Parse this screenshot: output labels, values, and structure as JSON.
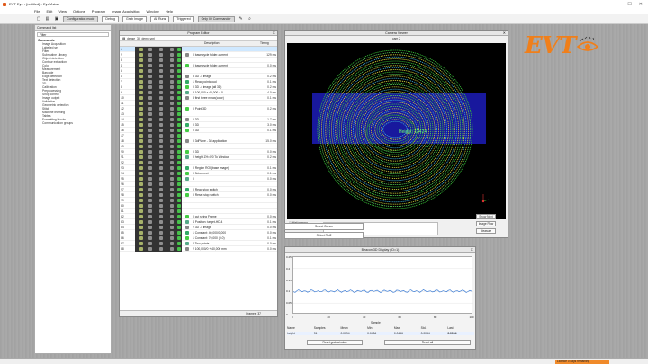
{
  "window": {
    "title": "EVT Eye - [untitled] - EyeVision",
    "controls": [
      "—",
      "☐",
      "✕"
    ]
  },
  "menu": [
    "File",
    "Edit",
    "View",
    "Options",
    "Program",
    "Image Acquisition",
    "Window",
    "Help"
  ],
  "toolbar": {
    "config": "Configuration mode",
    "debug": "Debug",
    "grab": "Grab Image",
    "all_runs": "All Runs",
    "triggered": "Triggered",
    "device": "Only IO Commander"
  },
  "commands": {
    "title": "Command list",
    "filter": "Filter",
    "group": "Commands",
    "items": [
      "Image Acquisition",
      "Labelled set",
      "Filter",
      "Subroutine Library",
      "Object detection",
      "Contour extraction",
      "Color",
      "Measurement",
      "Barcode",
      "Edge detection",
      "Text detection",
      "3D",
      "Calibration",
      "Preprocessing",
      "Shop control",
      "Image output",
      "Validation",
      "Geometric detection",
      "Stitch",
      "Machine learning",
      "Tables",
      "Formatting blocks",
      "Communication groups"
    ]
  },
  "program": {
    "title": "Program Editor",
    "tab": "dense_3d_demo.vprj",
    "col_step": "Description",
    "col_time": "Timing",
    "footer": "Frames: 37",
    "rows": [
      {
        "n": "1",
        "step": "",
        "t": "",
        "sel": true
      },
      {
        "n": "2",
        "step": "0 base cycle folder-current",
        "t": "129 ms"
      },
      {
        "n": "3",
        "step": "",
        "t": ""
      },
      {
        "n": "4",
        "step": "0 base cycle folder-current",
        "t": "0.0 ms"
      },
      {
        "n": "5",
        "step": "",
        "t": ""
      },
      {
        "n": "6",
        "step": "3 3D -> image",
        "t": "0.2 ms"
      },
      {
        "n": "7",
        "step": "1 Read pointcloud",
        "t": "0.1 ms"
      },
      {
        "n": "8",
        "step": "0 3D -> image (all 3D)",
        "t": "0.2 ms"
      },
      {
        "n": "9",
        "step": "3 100,000 x 40,000 = 0",
        "t": "4.0 ms"
      },
      {
        "n": "10",
        "step": "3 first three nmax(color)",
        "t": "0.1 ms"
      },
      {
        "n": "11",
        "step": "",
        "t": ""
      },
      {
        "n": "12",
        "step": "0 Point 3D",
        "t": "0.2 ms"
      },
      {
        "n": "13",
        "step": "",
        "t": ""
      },
      {
        "n": "14",
        "step": "0 3D",
        "t": "1.7 ms"
      },
      {
        "n": "15",
        "step": "0 3D",
        "t": "3.0 ms"
      },
      {
        "n": "16",
        "step": "0 3D",
        "t": "0.1 ms"
      },
      {
        "n": "17",
        "step": "",
        "t": ""
      },
      {
        "n": "18",
        "step": "0 3dPlane - 3d application",
        "t": "15.0 ms"
      },
      {
        "n": "19",
        "step": "",
        "t": ""
      },
      {
        "n": "20",
        "step": "0 3D",
        "t": "0.0 ms"
      },
      {
        "n": "21",
        "step": "0 height ZH=0/0 To Window",
        "t": "0.2 ms"
      },
      {
        "n": "22",
        "step": "",
        "t": ""
      },
      {
        "n": "23",
        "step": "0 Region ROI (base image)",
        "t": "0.1 ms"
      },
      {
        "n": "24",
        "step": "0 3d-correct",
        "t": "0.1 ms"
      },
      {
        "n": "25",
        "step": "0",
        "t": "0.0 ms"
      },
      {
        "n": "26",
        "step": "",
        "t": ""
      },
      {
        "n": "27",
        "step": "0 Read stop switch",
        "t": "0.0 ms"
      },
      {
        "n": "28",
        "step": "0 Reset stop switch",
        "t": "0.0 ms"
      },
      {
        "n": "29",
        "step": "",
        "t": ""
      },
      {
        "n": "30",
        "step": "",
        "t": ""
      },
      {
        "n": "31",
        "step": "",
        "t": ""
      },
      {
        "n": "32",
        "step": "0 cut string Frame",
        "t": "0.0 ms"
      },
      {
        "n": "33",
        "step": "4 Position: target-HD.4",
        "t": "0.1 ms"
      },
      {
        "n": "34",
        "step": "2 3D -> image",
        "t": "0.0 ms"
      },
      {
        "n": "35",
        "step": "1 Constant: 40,000/0,000",
        "t": "0.0 ms"
      },
      {
        "n": "36",
        "step": "1 Constant: 70,000 (0.0)",
        "t": "0.1 ms"
      },
      {
        "n": "37",
        "step": "2 Two points",
        "t": "0.0 ms"
      },
      {
        "n": "38",
        "step": "2 100,000/0 + 40,000 mm",
        "t": "0.0 ms"
      }
    ]
  },
  "camera": {
    "title": "Camera Viewer",
    "sub": "cam 2",
    "overlay": "Height: 13424",
    "checks": [
      "Hist/gamma",
      "auto center",
      "auto scale"
    ],
    "buttons": [
      "Show Next",
      "Image Flow",
      "Measure"
    ]
  },
  "select": {
    "a": "Select Cursor",
    "b": "Select Roi2"
  },
  "plot": {
    "title": "Beacon 3D Display (ID=1)",
    "yticks": [
      "0.25",
      "0.2",
      "0.15",
      "0.1",
      "0.05",
      "0"
    ],
    "xticks": [
      "0",
      "20",
      "40",
      "60",
      "80",
      "100"
    ],
    "xlabel": "Sample",
    "stats_head": [
      "Name",
      "Samples",
      "Mean",
      "Min",
      "Max",
      "Std.",
      "Last"
    ],
    "stats_row": [
      "height",
      "91",
      "0.0094",
      "0.0484",
      "0.0456",
      "0.0044",
      "0.0094"
    ],
    "btn_reset": "Reset grab window",
    "btn_all": "Reset all",
    "series_color": "#3a7bd5"
  },
  "status": {
    "warn": "Licence 0 days remaining"
  },
  "logo": "EVT"
}
